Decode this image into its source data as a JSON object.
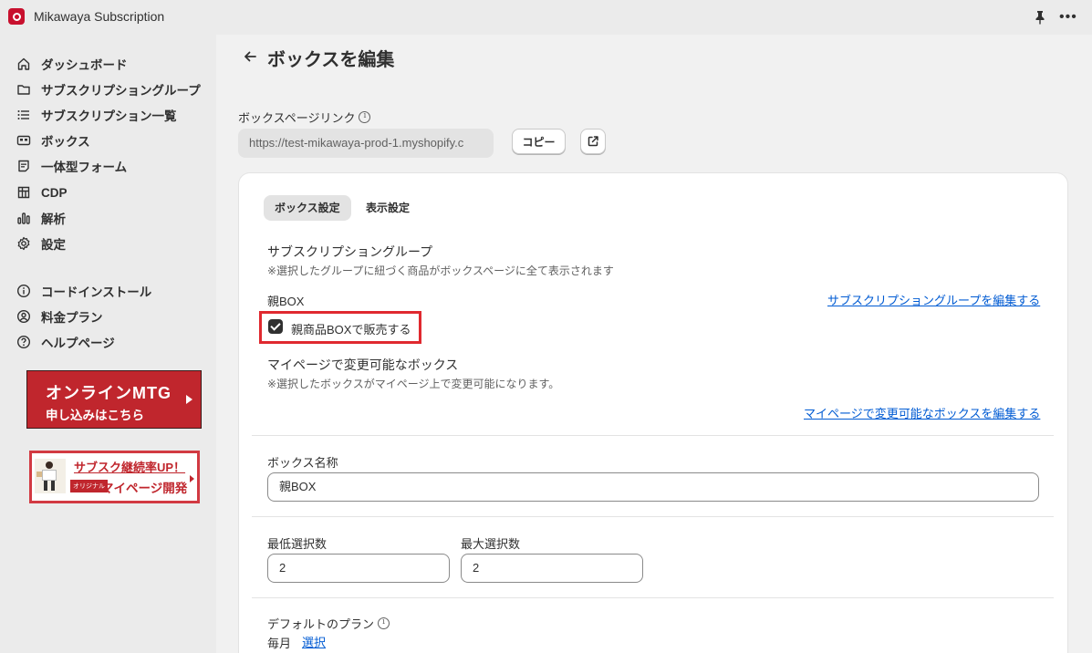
{
  "app": {
    "title": "Mikawaya Subscription"
  },
  "sidebar": {
    "items": [
      {
        "label": "ダッシュボード",
        "icon": "home-icon"
      },
      {
        "label": "サブスクリプショングループ",
        "icon": "folder-icon"
      },
      {
        "label": "サブスクリプション一覧",
        "icon": "list-icon"
      },
      {
        "label": "ボックス",
        "icon": "box-icon"
      },
      {
        "label": "一体型フォーム",
        "icon": "form-icon"
      },
      {
        "label": "CDP",
        "icon": "grid-icon"
      },
      {
        "label": "解析",
        "icon": "analytics-icon"
      },
      {
        "label": "設定",
        "icon": "gear-icon"
      },
      {
        "label": "コードインストール",
        "icon": "info-icon"
      },
      {
        "label": "料金プラン",
        "icon": "person-icon"
      },
      {
        "label": "ヘルプページ",
        "icon": "help-icon"
      }
    ],
    "banner_mtg": {
      "line1": "オンラインMTG",
      "line2": "申し込みはこちら"
    },
    "banner_mypage": {
      "line1": "サブスク継続率UP！",
      "tag": "オリジナル",
      "line2": "マイページ開発"
    }
  },
  "page": {
    "title": "ボックスを編集"
  },
  "box_link": {
    "label": "ボックスページリンク",
    "url": "https://test-mikawaya-prod-1.myshopify.c",
    "copy_label": "コピー"
  },
  "tabs": [
    {
      "label": "ボックス設定",
      "active": true
    },
    {
      "label": "表示設定",
      "active": false
    }
  ],
  "subscription_group": {
    "title": "サブスクリプショングループ",
    "note": "※選択したグループに紐づく商品がボックスページに全て表示されます",
    "group_name": "親BOX",
    "edit_link": "サブスクリプショングループを編集する",
    "checkbox_label": "親商品BOXで販売する",
    "checked": true
  },
  "mypage_boxes": {
    "title": "マイページで変更可能なボックス",
    "note": "※選択したボックスがマイページ上で変更可能になります。",
    "edit_link": "マイページで変更可能なボックスを編集する"
  },
  "box_name": {
    "label": "ボックス名称",
    "value": "親BOX"
  },
  "min_select": {
    "label": "最低選択数",
    "value": "2"
  },
  "max_select": {
    "label": "最大選択数",
    "value": "2"
  },
  "default_plan": {
    "label": "デフォルトのプラン",
    "value": "毎月",
    "select_link": "選択"
  },
  "colors": {
    "accent": "#005bd3",
    "highlight": "#e0292f",
    "brand": "#c0262d"
  }
}
